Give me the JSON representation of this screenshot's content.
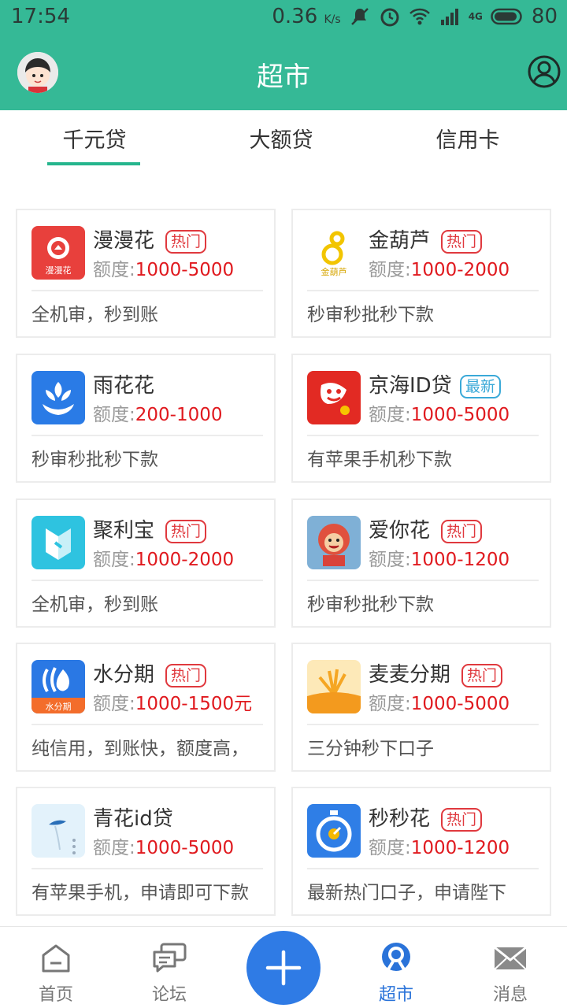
{
  "status_bar": {
    "time": "17:54",
    "speed": "0.36",
    "speed_unit": "K/s",
    "battery": "80",
    "network": "4G"
  },
  "header": {
    "title": "超市"
  },
  "tabs": [
    {
      "label": "千元贷",
      "active": true
    },
    {
      "label": "大额贷",
      "active": false
    },
    {
      "label": "信用卡",
      "active": false
    }
  ],
  "products": [
    {
      "name": "漫漫花",
      "badge": "热门",
      "limit_label": "额度:",
      "limit": "1000-5000",
      "desc": "全机审，秒到账",
      "logo": "manmanhua-logo",
      "logo_text": "漫漫花"
    },
    {
      "name": "金葫芦",
      "badge": "热门",
      "limit_label": "额度:",
      "limit": "1000-2000",
      "desc": "秒审秒批秒下款",
      "logo": "jinhulu-logo",
      "logo_text": "金葫芦"
    },
    {
      "name": "雨花花",
      "badge": "",
      "limit_label": "额度:",
      "limit": "200-1000",
      "desc": "秒审秒批秒下款",
      "logo": "yuhuahua-logo"
    },
    {
      "name": "京海ID贷",
      "badge": "最新",
      "limit_label": "额度:",
      "limit": "1000-5000",
      "desc": "有苹果手机秒下款",
      "logo": "jinghai-logo"
    },
    {
      "name": "聚利宝",
      "badge": "热门",
      "limit_label": "额度:",
      "limit": "1000-2000",
      "desc": "全机审，秒到账",
      "logo": "julibao-logo"
    },
    {
      "name": "爱你花",
      "badge": "热门",
      "limit_label": "额度:",
      "limit": "1000-1200",
      "desc": "秒审秒批秒下款",
      "logo": "ainihua-logo"
    },
    {
      "name": "水分期",
      "badge": "热门",
      "limit_label": "额度:",
      "limit": "1000-1500元",
      "desc": "纯信用，到账快，额度高，",
      "logo": "shuifenqi-logo",
      "logo_text": "水分期"
    },
    {
      "name": "麦麦分期",
      "badge": "热门",
      "limit_label": "额度:",
      "limit": "1000-5000",
      "desc": "三分钟秒下口子",
      "logo": "maimai-logo"
    },
    {
      "name": "青花id贷",
      "badge": "",
      "limit_label": "额度:",
      "limit": "1000-5000",
      "desc": "有苹果手机，申请即可下款",
      "logo": "qinghua-logo"
    },
    {
      "name": "秒秒花",
      "badge": "热门",
      "limit_label": "额度:",
      "limit": "1000-1200",
      "desc": "最新热门口子，申请陛下",
      "logo": "miaomiao-logo"
    }
  ],
  "bottom_nav": [
    {
      "label": "首页",
      "icon": "home-icon",
      "active": false
    },
    {
      "label": "论坛",
      "icon": "forum-icon",
      "active": false
    },
    {
      "label": "超市",
      "icon": "market-icon",
      "active": true
    },
    {
      "label": "消息",
      "icon": "message-icon",
      "active": false
    }
  ],
  "colors": {
    "brand": "#35b996",
    "tab_underline": "#25b58d",
    "limit_value": "#e0191e",
    "badge_hot": "#e0393e",
    "badge_new": "#3aa9d8",
    "nav_active": "#2a73d9",
    "plus_button": "#2f7be5"
  }
}
